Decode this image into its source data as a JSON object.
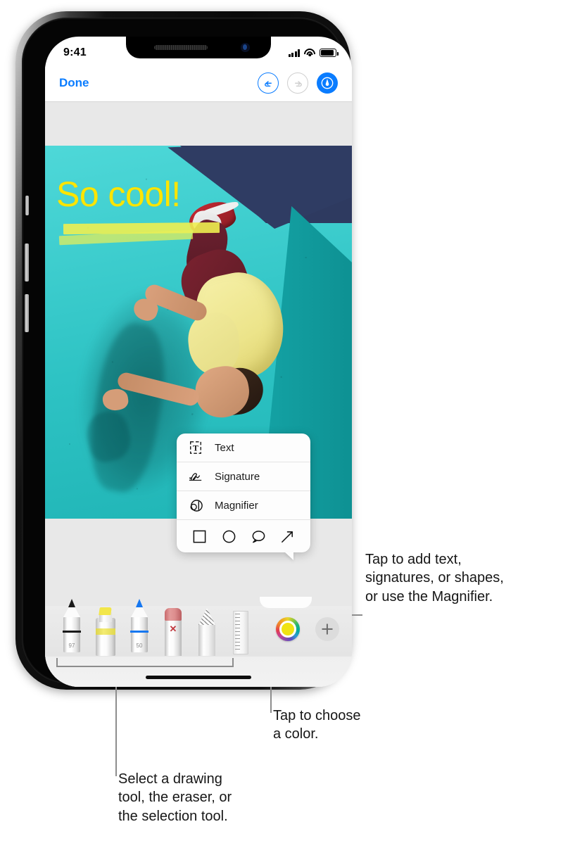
{
  "status_bar": {
    "time": "9:41",
    "signal_icon": "cellular-signal-icon",
    "wifi_icon": "wifi-icon",
    "battery_icon": "battery-icon"
  },
  "nav_bar": {
    "done_label": "Done",
    "undo_icon": "undo-arrow-icon",
    "redo_icon": "redo-arrow-icon",
    "markup_icon": "markup-pen-icon",
    "accent_color": "#0a7cff",
    "disabled_color": "#cfcfcf"
  },
  "photo": {
    "annotation_text": "So cool!",
    "annotation_color": "#ffe500",
    "highlight_color": "#eeee50",
    "wall_color": "#2ec3c4",
    "sky_color": "#2e3a60"
  },
  "popup_menu": {
    "items": [
      {
        "label": "Text",
        "icon": "text-box-icon"
      },
      {
        "label": "Signature",
        "icon": "signature-icon"
      },
      {
        "label": "Magnifier",
        "icon": "magnifier-icon"
      }
    ],
    "shapes": [
      {
        "name": "square-shape-icon"
      },
      {
        "name": "circle-shape-icon"
      },
      {
        "name": "speech-bubble-shape-icon"
      },
      {
        "name": "arrow-shape-icon"
      }
    ]
  },
  "toolbar": {
    "tools": [
      {
        "name": "pen-tool",
        "value": "97"
      },
      {
        "name": "highlighter-tool",
        "value": ""
      },
      {
        "name": "pencil-tool",
        "value": "50"
      },
      {
        "name": "eraser-tool",
        "value": ""
      },
      {
        "name": "lasso-selection-tool",
        "value": ""
      },
      {
        "name": "ruler-tool",
        "value": ""
      }
    ],
    "color_wheel": {
      "name": "color-wheel-button",
      "selected_color": "#f0e312"
    },
    "add_button": {
      "name": "add-button",
      "label": "+"
    }
  },
  "callouts": {
    "add_text": "Tap to add text,\nsignatures, or shapes,\nor use the Magnifier.",
    "choose_color": "Tap to choose\na color.",
    "select_tool": "Select a drawing\ntool, the eraser, or\nthe selection tool."
  }
}
